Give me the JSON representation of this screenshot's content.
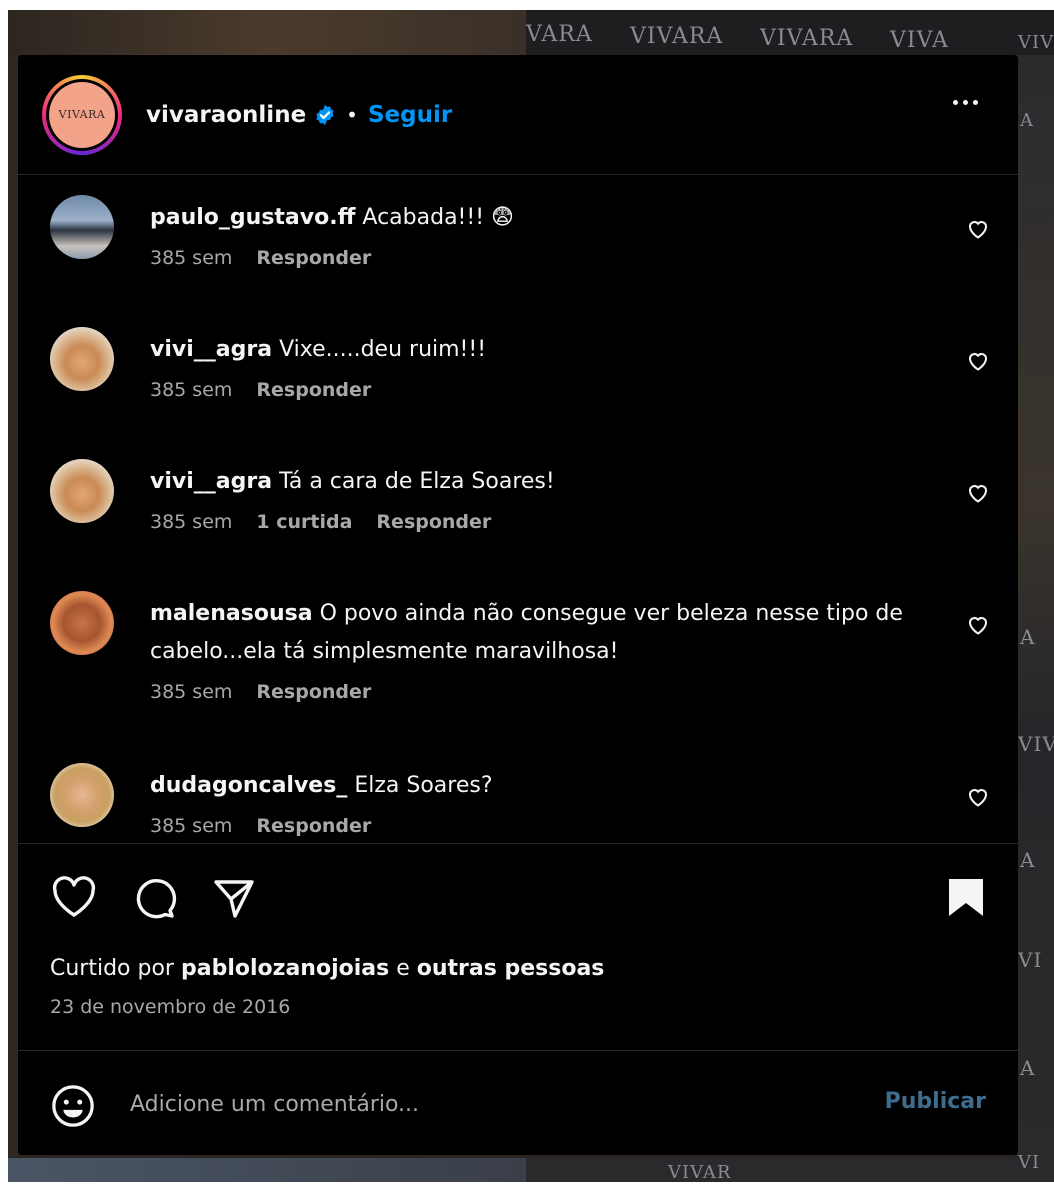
{
  "backdrop": {
    "watermarks": [
      "VARA",
      "VIVARA",
      "VIVARA",
      "VIVA",
      "VIV",
      "A",
      "A",
      "VIV",
      "A",
      "VI",
      "A",
      "VI",
      "VIVAR"
    ]
  },
  "post": {
    "avatar_logo": "VIVARA",
    "username": "vivaraonline",
    "separator": "•",
    "follow_label": "Seguir",
    "more_icon": "more-horizontal-icon"
  },
  "comments": [
    {
      "username": "paulo_gustavo.ff",
      "text": "Acabada!!! 😨",
      "time": "385 sem",
      "likes": "",
      "reply": "Responder"
    },
    {
      "username": "vivi__agra",
      "text": "Vixe.....deu ruim!!!",
      "time": "385 sem",
      "likes": "",
      "reply": "Responder"
    },
    {
      "username": "vivi__agra",
      "text": "Tá a cara de Elza Soares!",
      "time": "385 sem",
      "likes": "1 curtida",
      "reply": "Responder"
    },
    {
      "username": "malenasousa",
      "text": "O povo ainda não consegue ver beleza nesse tipo de cabelo...ela tá simplesmente maravilhosa!",
      "time": "385 sem",
      "likes": "",
      "reply": "Responder"
    },
    {
      "username": "dudagoncalves_",
      "text": "Elza Soares?",
      "time": "385 sem",
      "likes": "",
      "reply": "Responder"
    }
  ],
  "actions": {
    "icons": [
      "heart-icon",
      "comment-icon",
      "share-icon",
      "bookmark-icon"
    ],
    "liked_by_prefix": "Curtido por",
    "liked_by_user": "pablolozanojoias",
    "liked_by_connector": "e",
    "liked_by_others": "outras pessoas",
    "date": "23 de novembro de 2016"
  },
  "add_comment": {
    "placeholder": "Adicione um comentário...",
    "publish_label": "Publicar",
    "emoji_icon": "emoji-icon"
  },
  "colors": {
    "background": "#000000",
    "accent": "#0095f6",
    "publish_disabled": "#3f6d8f",
    "secondary_text": "#a8a8a8"
  }
}
